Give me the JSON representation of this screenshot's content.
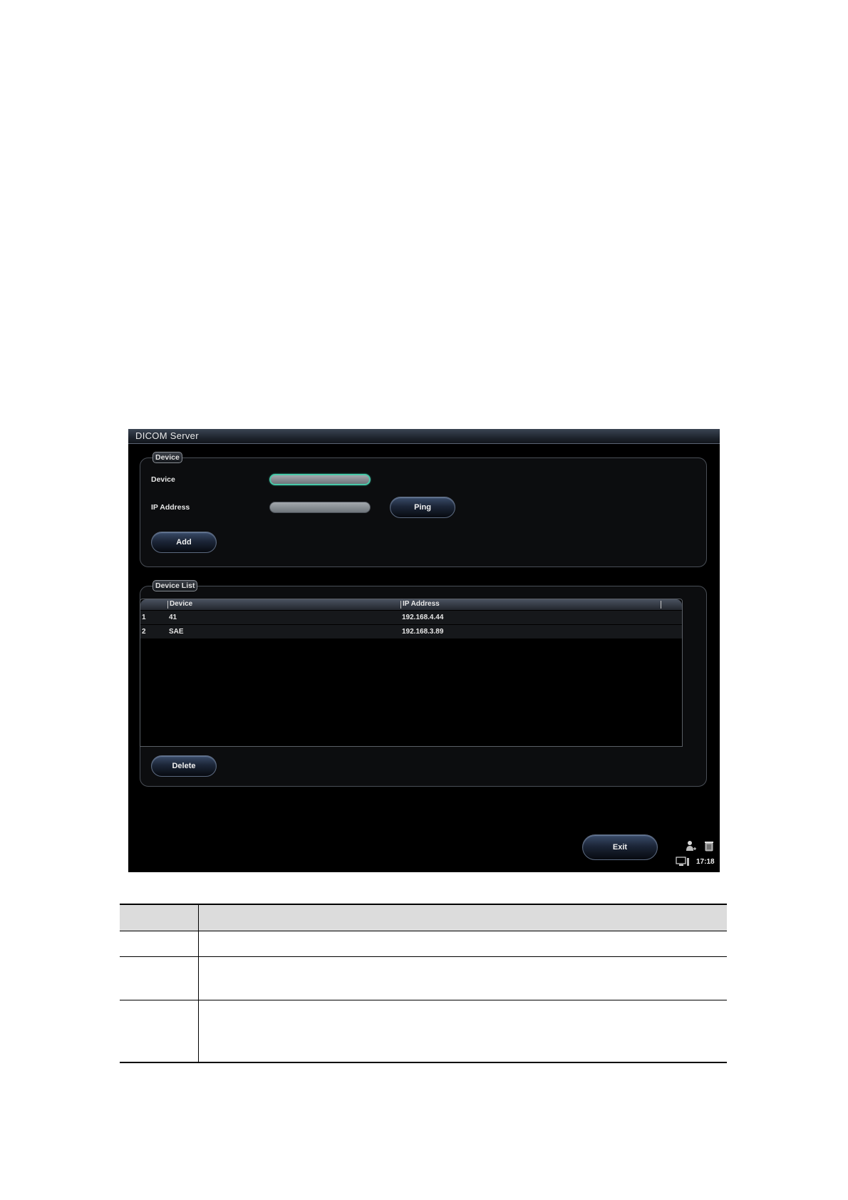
{
  "window": {
    "title": "DICOM Server"
  },
  "device_group": {
    "label": "Device",
    "device_label": "Device",
    "device_value": "",
    "ip_label": "IP Address",
    "ip_value": "",
    "ping_label": "Ping",
    "add_label": "Add"
  },
  "device_list_group": {
    "label": "Device List",
    "columns": [
      "Device",
      "IP Address"
    ],
    "rows": [
      {
        "index": "1",
        "device": "41",
        "ip": "192.168.4.44"
      },
      {
        "index": "2",
        "device": "SAE",
        "ip": "192.168.3.89"
      }
    ],
    "delete_label": "Delete"
  },
  "footer": {
    "exit_label": "Exit",
    "time": "17:18",
    "icons": [
      "user-icon",
      "trash-icon",
      "monitor-icon"
    ]
  },
  "colors": {
    "window_background": "#000000",
    "focus_border": "#49c8a8",
    "button_gradient_top": "#3a4c6a"
  }
}
